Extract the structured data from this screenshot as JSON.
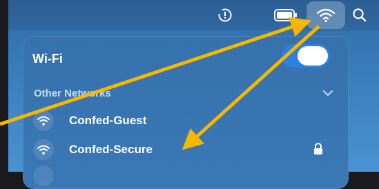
{
  "menubar": {
    "icons": [
      "warning-icon",
      "battery-icon",
      "wifi-icon",
      "search-icon"
    ]
  },
  "wifi_panel": {
    "title": "Wi-Fi",
    "toggle_on": true,
    "other_networks_label": "Other Networks",
    "networks": [
      {
        "name": "Confed-Guest",
        "secured": false
      },
      {
        "name": "Confed-Secure",
        "secured": true
      }
    ]
  },
  "annotation": {
    "arrow_color": "#f5b700"
  },
  "colors": {
    "toggle_on": "#2f7fe3",
    "panel": "#3671ad"
  }
}
